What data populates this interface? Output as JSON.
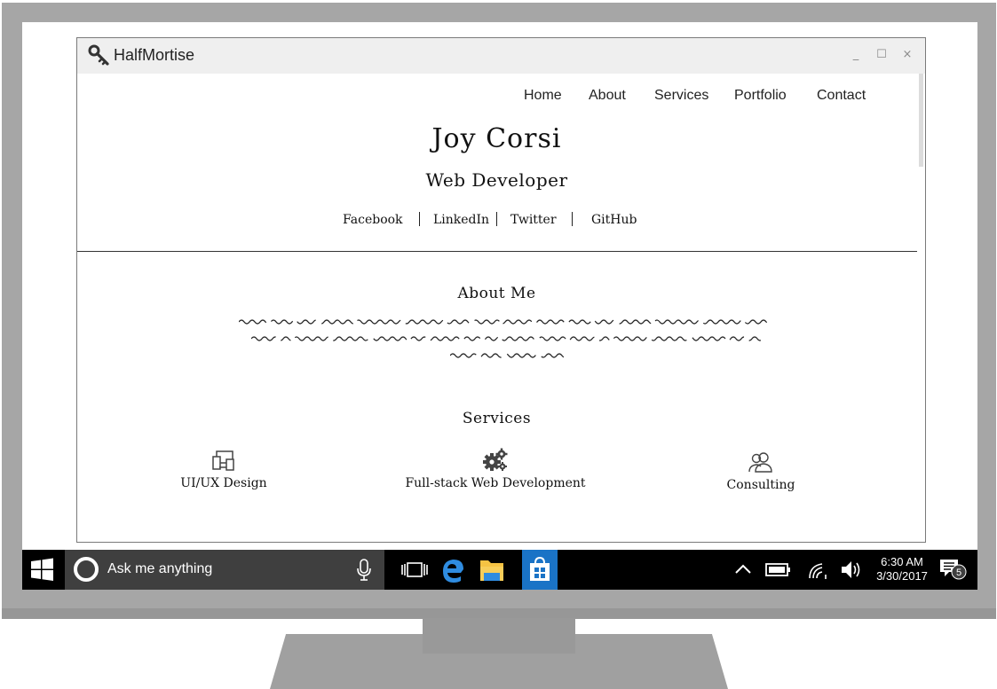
{
  "window": {
    "title": "HalfMortise",
    "app_icon": "key-icon",
    "minimize_glyph": "_",
    "maximize_glyph": "☐",
    "close_glyph": "×"
  },
  "nav": {
    "items": [
      "Home",
      "About",
      "Services",
      "Portfolio",
      "Contact"
    ]
  },
  "hero": {
    "name": "Joy Corsi",
    "role": "Web Developer"
  },
  "social": {
    "links": [
      "Facebook",
      "LinkedIn",
      "Twitter",
      "GitHub"
    ]
  },
  "about": {
    "title": "About Me"
  },
  "services": {
    "title": "Services",
    "items": [
      {
        "label": "UI/UX Design",
        "icon": "devices-icon"
      },
      {
        "label": "Full-stack Web Development",
        "icon": "gears-icon"
      },
      {
        "label": "Consulting",
        "icon": "people-icon"
      }
    ]
  },
  "taskbar": {
    "search_placeholder": "Ask me anything",
    "time": "6:30 AM",
    "date": "3/30/2017",
    "notification_count": "5"
  },
  "colors": {
    "taskbar_bg": "#000000",
    "search_bg": "#3f3f3f",
    "store_accent": "#1a73c6",
    "edge_blue": "#2f8ce0",
    "explorer_yellow": "#f5c343",
    "monitor_gray": "#a6a6a6"
  }
}
